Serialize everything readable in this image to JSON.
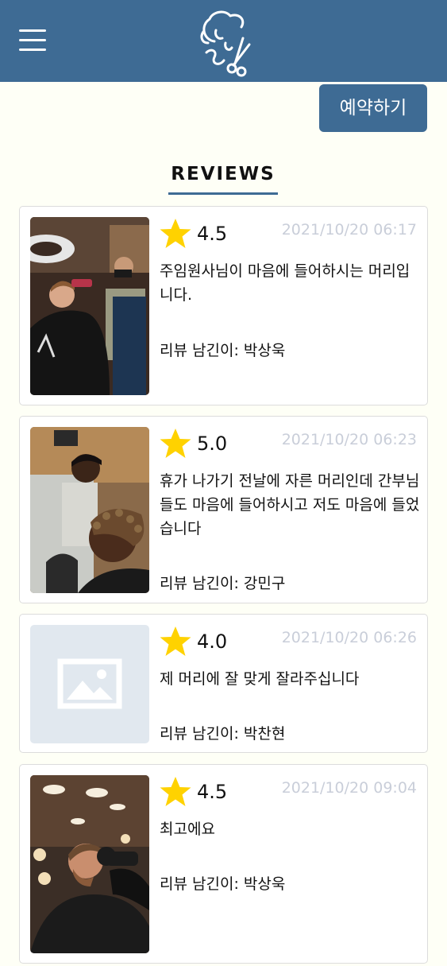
{
  "header": {
    "menu_icon": "hamburger-menu-icon",
    "logo_icon": "barber-scissors-logo-icon",
    "accent": "#3e6b94"
  },
  "reserve_button": "예약하기",
  "section_title": "REVIEWS",
  "reviews": [
    {
      "rating": "4.5",
      "date": "2021/10/20 06:17",
      "text": "주임원사님이 마음에 들어하시는 머리입니다.",
      "author": "리뷰 남긴이: 박상욱",
      "image": "barber-photo"
    },
    {
      "rating": "5.0",
      "date": "2021/10/20 06:23",
      "text": "휴가 나가기 전날에 자른 머리인데 간부님들도 마음에 들어하시고 저도 마음에 들었습니다",
      "author": "리뷰 남긴이: 강민구",
      "image": "barber-photo"
    },
    {
      "rating": "4.0",
      "date": "2021/10/20 06:26",
      "text": "제 머리에 잘 맞게 잘라주십니다",
      "author": "리뷰 남긴이: 박찬현",
      "image": "image-placeholder-icon"
    },
    {
      "rating": "4.5",
      "date": "2021/10/20 09:04",
      "text": "최고에요",
      "author": "리뷰 남긴이: 박상욱",
      "image": "barber-photo"
    }
  ],
  "colors": {
    "star": "#ffd200",
    "date": "#c9ced9",
    "background": "#fefff6"
  }
}
